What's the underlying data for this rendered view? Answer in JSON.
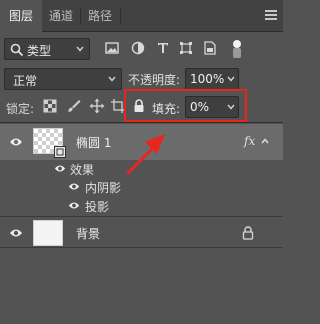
{
  "tabs": [
    {
      "label": "图层",
      "active": true
    },
    {
      "label": "通道",
      "active": false
    },
    {
      "label": "路径",
      "active": false
    }
  ],
  "filter": {
    "kind_label": "类型",
    "icons": [
      "image-filter-icon",
      "adjustment-filter-icon",
      "type-filter-icon",
      "shape-filter-icon",
      "smart-object-filter-icon",
      "filter-toggle-icon"
    ]
  },
  "blend": {
    "mode": "正常",
    "opacity_label": "不透明度:",
    "opacity_value": "100%"
  },
  "lock": {
    "label": "锁定:",
    "icons": [
      "lock-transparent-pixels-icon",
      "lock-image-pixels-icon",
      "lock-position-icon",
      "lock-artboard-icon",
      "lock-all-icon"
    ],
    "fill_label": "填充:",
    "fill_value": "0%"
  },
  "layers": [
    {
      "name": "椭圆 1",
      "selected": true,
      "fx_badge": "fx",
      "effects_label": "效果",
      "effects": [
        "内阴影",
        "投影"
      ]
    },
    {
      "name": "背景",
      "selected": false,
      "locked": true
    }
  ],
  "annotation": {
    "highlight_color": "#e8261d"
  }
}
